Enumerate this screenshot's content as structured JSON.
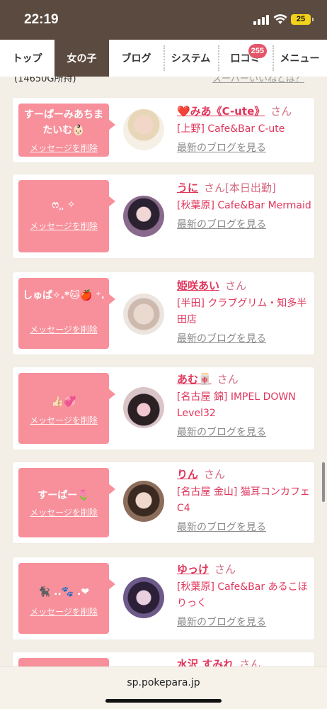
{
  "status_bar": {
    "time": "22:19",
    "battery": "25"
  },
  "nav": {
    "tabs": [
      {
        "label": "トップ"
      },
      {
        "label": "女の子",
        "active": true
      },
      {
        "label": "ブログ"
      },
      {
        "label": "システム"
      },
      {
        "label": "口コミ",
        "badge": "255"
      },
      {
        "label": "メニュー"
      }
    ]
  },
  "header": {
    "points_note": "(14650G所持)",
    "super_link": "スーパーいいねとは？"
  },
  "delete_label": "メッセージを削除",
  "blog_label": "最新のブログを見る",
  "cards": [
    {
      "message": "すーぱーみあちまたいむ👶🏻",
      "name": "❤️みあ《C-ute》",
      "suffix": "さん",
      "status": "",
      "shop": "[上野] Cafe&Bar C-ute"
    },
    {
      "message": "ෆ⸒⸒ ✧",
      "name": "うに",
      "suffix": "さん",
      "status": "[本日出勤]",
      "shop": "[秋葉原] Cafe&Bar Mermaid"
    },
    {
      "message": "しゅぱ✧.*🐱🍎 ⁺.",
      "name": "姫咲あい",
      "suffix": "さん",
      "status": "",
      "shop": "[半田] クラブグリム・知多半田店"
    },
    {
      "message": "👍🏻💞",
      "name": "あむ🀄",
      "suffix": "さん",
      "status": "",
      "shop": "[名古屋 錦] IMPEL DOWN Level32"
    },
    {
      "message": "すーぱー🌷",
      "name": "りん",
      "suffix": "さん",
      "status": "",
      "shop": "[名古屋 金山] 猫耳コンカフェ C4"
    },
    {
      "message": "🐈‍⬛ ..🐾 .❤",
      "name": "ゆっけ",
      "suffix": "さん",
      "status": "",
      "shop": "[秋葉原] Cafe&Bar あるこほりっく"
    },
    {
      "message": "",
      "name": "水沢 すみれ",
      "suffix": "さん",
      "status": "",
      "shop": ""
    }
  ],
  "url": "sp.pokepara.jp",
  "colors": {
    "brand_brown": "#5b4a3f",
    "bubble_pink": "#f7909b",
    "name_pink": "#e0365b",
    "badge_red": "#e3566a"
  }
}
